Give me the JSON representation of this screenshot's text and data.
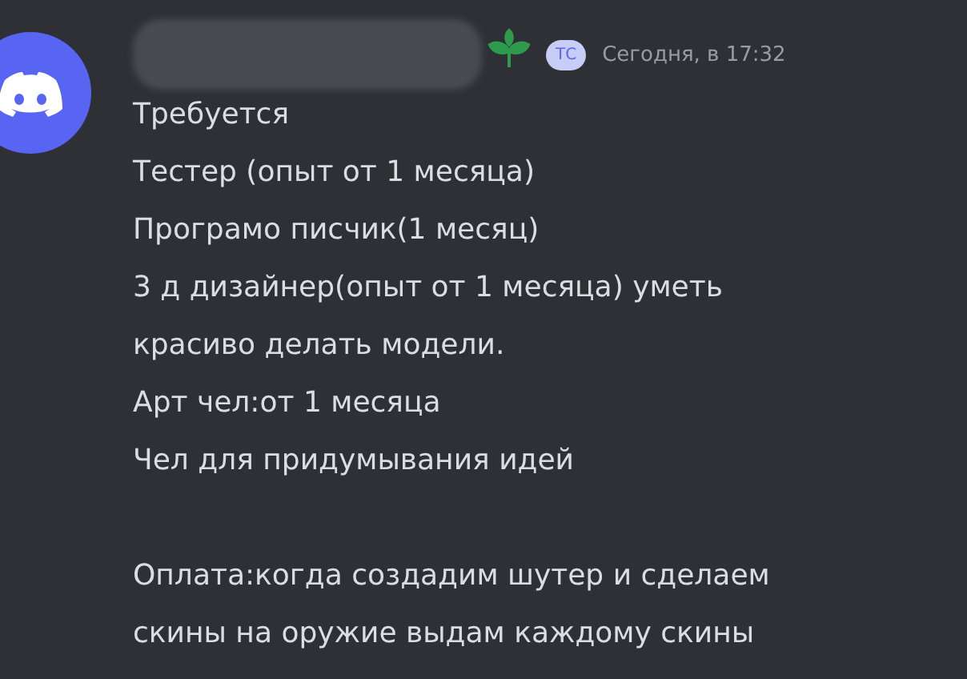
{
  "message": {
    "tag": "ТС",
    "timestamp": "Сегодня, в 17:32",
    "paragraphs": [
      [
        "Требуется",
        "Тестер (опыт от 1 месяца)",
        "Програмо писчик(1 месяц)",
        "3 д дизайнер(опыт от 1 месяца) уметь",
        "красиво делать модели.",
        "Арт чел:от 1 месяца",
        "Чел для придумывания идей"
      ],
      [
        "Оплата:когда создадим шутер и сделаем",
        "скины на оружие выдам каждому скины"
      ]
    ]
  }
}
